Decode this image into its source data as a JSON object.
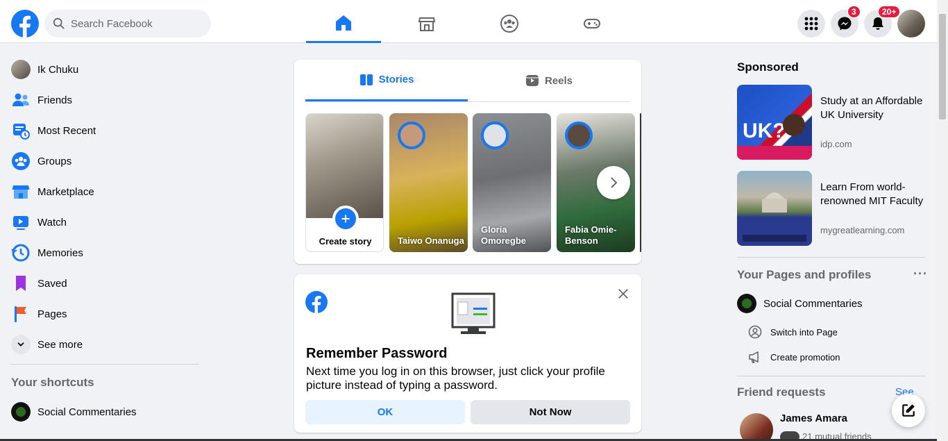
{
  "header": {
    "search_placeholder": "Search Facebook",
    "messenger_badge": "3",
    "notifications_badge": "20+"
  },
  "left_nav": {
    "profile_name": "Ik Chuku",
    "items": [
      {
        "label": "Friends",
        "icon": "friends-icon"
      },
      {
        "label": "Most Recent",
        "icon": "most-recent-icon"
      },
      {
        "label": "Groups",
        "icon": "groups-icon"
      },
      {
        "label": "Marketplace",
        "icon": "marketplace-icon"
      },
      {
        "label": "Watch",
        "icon": "watch-icon"
      },
      {
        "label": "Memories",
        "icon": "memories-icon"
      },
      {
        "label": "Saved",
        "icon": "saved-icon"
      },
      {
        "label": "Pages",
        "icon": "pages-icon"
      }
    ],
    "see_more": "See more",
    "shortcuts_title": "Your shortcuts",
    "shortcuts": [
      {
        "label": "Social Commentaries"
      }
    ]
  },
  "stories": {
    "tabs": [
      "Stories",
      "Reels"
    ],
    "create_label": "Create story",
    "items": [
      {
        "name": "Taiwo Onanuga"
      },
      {
        "name": "Gloria Omoregbe"
      },
      {
        "name": "Fabia Omie-Benson"
      }
    ]
  },
  "remember_password": {
    "title": "Remember Password",
    "text": "Next time you log in on this browser, just click your profile picture instead of typing a password.",
    "ok_label": "OK",
    "not_now_label": "Not Now"
  },
  "right": {
    "sponsored_title": "Sponsored",
    "ads": [
      {
        "title": "Study at an Affordable UK University",
        "domain": "idp.com"
      },
      {
        "title": "Learn From world-renowned MIT Faculty",
        "domain": "mygreatlearning.com"
      }
    ],
    "pages_title": "Your Pages and profiles",
    "more_label": "···",
    "page_name": "Social Commentaries",
    "switch_label": "Switch into Page",
    "promo_label": "Create promotion",
    "friend_requests_title": "Friend requests",
    "see_all": "See all",
    "request_name": "James Amara",
    "request_mutual": "21 mutual friends"
  },
  "colors": {
    "brand": "#1877f2",
    "badge": "#e41e3f",
    "background": "#f0f2f5"
  }
}
